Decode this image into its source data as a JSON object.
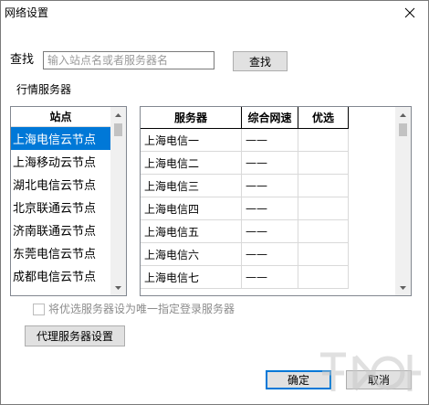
{
  "window": {
    "title": "网络设置"
  },
  "search": {
    "label": "查找",
    "placeholder": "输入站点名或者服务器名",
    "value": "",
    "button_label": "查找"
  },
  "section": {
    "label": "行情服务器"
  },
  "stations": {
    "header": "站点",
    "items": [
      {
        "label": "上海电信云节点",
        "selected": true
      },
      {
        "label": "上海移动云节点",
        "selected": false
      },
      {
        "label": "湖北电信云节点",
        "selected": false
      },
      {
        "label": "北京联通云节点",
        "selected": false
      },
      {
        "label": "济南联通云节点",
        "selected": false
      },
      {
        "label": "东莞电信云节点",
        "selected": false
      },
      {
        "label": "成都电信云节点",
        "selected": false
      }
    ]
  },
  "servers": {
    "columns": [
      "服务器",
      "综合网速",
      "优选"
    ],
    "rows": [
      {
        "name": "上海电信一",
        "speed": "——",
        "preferred": ""
      },
      {
        "name": "上海电信二",
        "speed": "——",
        "preferred": ""
      },
      {
        "name": "上海电信三",
        "speed": "——",
        "preferred": ""
      },
      {
        "name": "上海电信四",
        "speed": "——",
        "preferred": ""
      },
      {
        "name": "上海电信五",
        "speed": "——",
        "preferred": ""
      },
      {
        "name": "上海电信六",
        "speed": "——",
        "preferred": ""
      },
      {
        "name": "上海电信七",
        "speed": "——",
        "preferred": ""
      }
    ]
  },
  "options": {
    "only_preferred_label": "将优选服务器设为唯一指定登录服务器",
    "only_preferred_checked": false,
    "only_preferred_enabled": false
  },
  "buttons": {
    "proxy_label": "代理服务器设置",
    "ok_label": "确定",
    "cancel_label": "取消"
  },
  "colors": {
    "selection": "#0078d7",
    "button_face": "#e1e1e1",
    "disabled_text": "#8c8c8c"
  },
  "icons": {
    "close": "close-icon",
    "scroll_up": "scroll-up-arrow-icon",
    "scroll_down": "scroll-down-arrow-icon"
  }
}
